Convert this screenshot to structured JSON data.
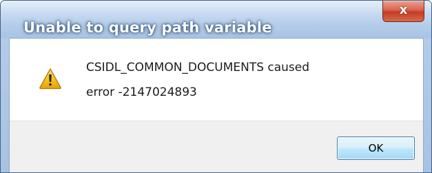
{
  "window": {
    "title": "Unable to query path variable",
    "close_label": "x"
  },
  "message": {
    "line1": "CSIDL_COMMON_DOCUMENTS caused",
    "line2": "error -2147024893",
    "icon": "warning-icon"
  },
  "buttons": {
    "ok_label": "OK"
  },
  "colors": {
    "title_text": "#ffffff",
    "close_button": "#c43c25",
    "warning_fill": "#f7c21b",
    "button_area": "#f0f0f0"
  }
}
